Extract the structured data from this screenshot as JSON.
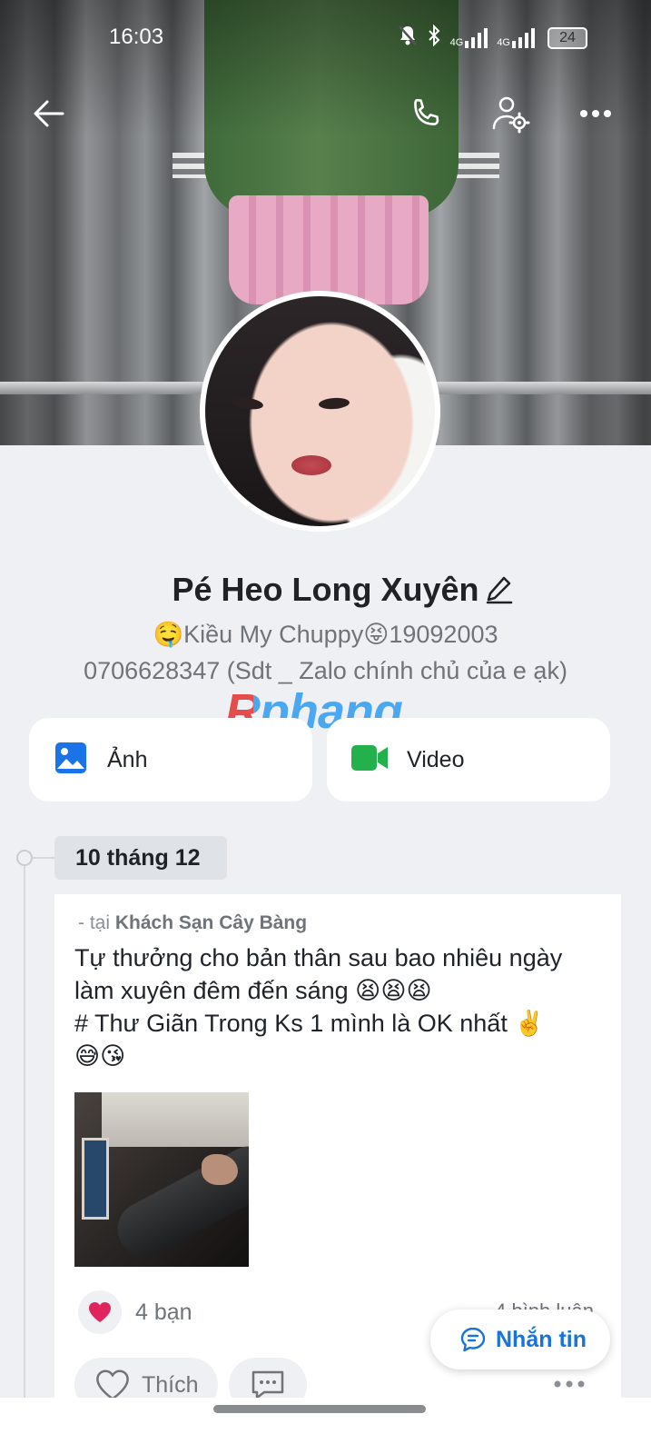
{
  "status_bar": {
    "time": "16:03",
    "network_1": "4G",
    "network_2": "4G",
    "battery": "24"
  },
  "nav": {
    "back_icon": "arrow-left-icon",
    "call_icon": "phone-icon",
    "settings_icon": "user-gear-icon",
    "more_icon": "more-horizontal-icon"
  },
  "profile": {
    "name": "Pé Heo Long Xuyên",
    "bio_line1": "🤤Kiều My Chuppy😝19092003",
    "bio_line2": "0706628347 (Sdt _ Zalo chính chủ của e ạk)"
  },
  "watermark": "Rphang",
  "media": {
    "photos_label": "Ảnh",
    "video_label": "Video",
    "photos_color": "#1a73e8",
    "video_color": "#22b14c"
  },
  "timeline": {
    "date": "10 tháng 12",
    "post": {
      "location_prefix": "- tại",
      "location": "Khách Sạn Cây Bàng",
      "text_lines": [
        "Tự thưởng cho bản thân sau bao nhiêu ngày",
        "làm xuyên đêm đến sáng  😫😫😫",
        "# Thư Giãn Trong Ks 1 mình là OK nhất ✌️",
        "😅😘"
      ],
      "reaction_count": "4 bạn",
      "comments": "4 bình luận",
      "like_label": "Thích"
    }
  },
  "fab": {
    "label": "Nhắn tin"
  },
  "colors": {
    "accent": "#1a73d9",
    "heart": "#e0245e"
  }
}
